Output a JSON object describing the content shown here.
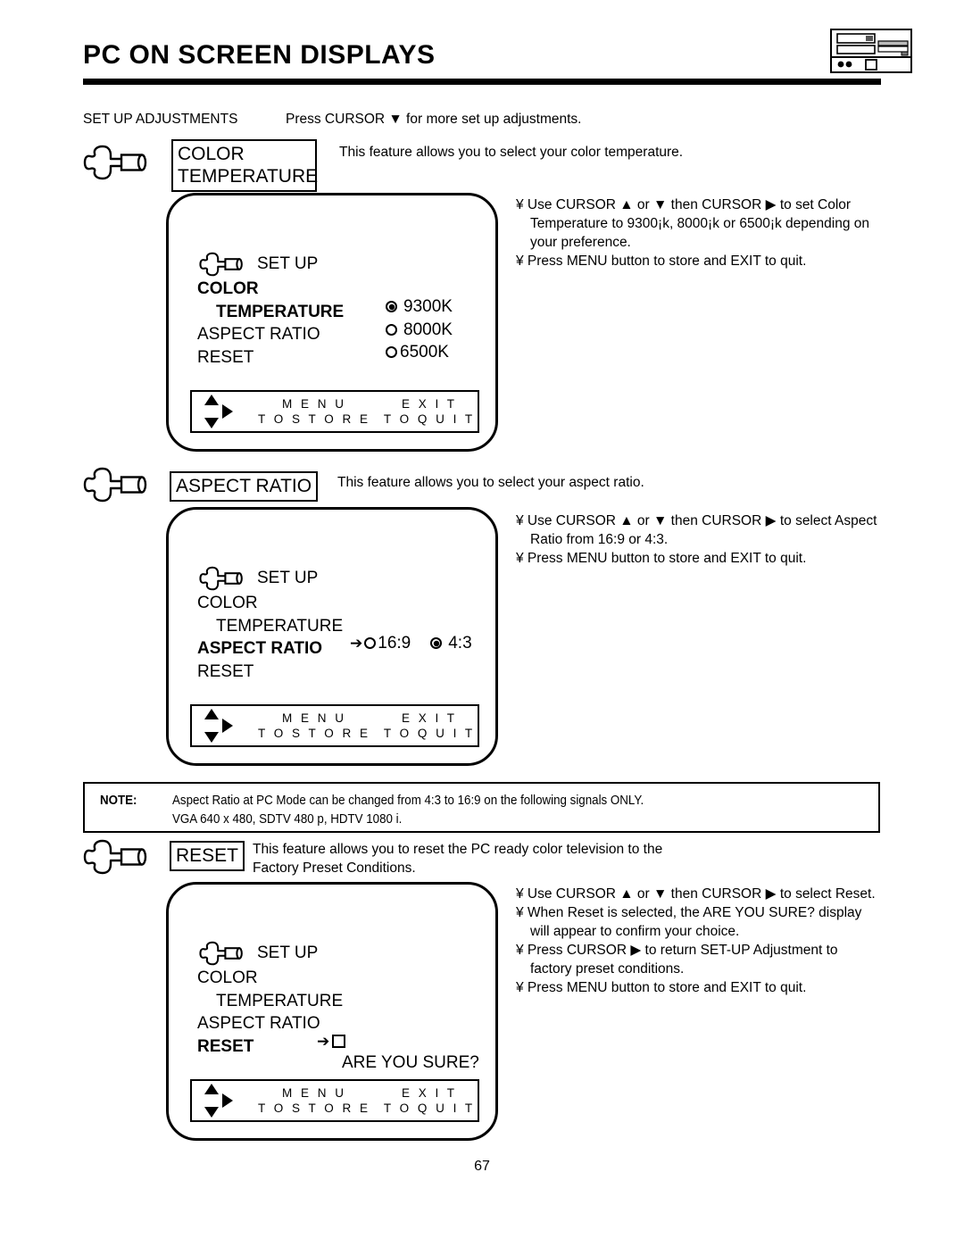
{
  "header": {
    "title": "PC ON SCREEN DISPLAYS",
    "device_icon": "vcr-dvd-player-icon"
  },
  "intro": {
    "label": "SET UP ADJUSTMENTS",
    "text": "Press CURSOR ▼ for more set up adjustments."
  },
  "sections": [
    {
      "icon": "setup-wrench-icon",
      "box_label": "COLOR\nTEMPERATURE",
      "intro": "This feature allows you to select your color temperature.",
      "bullets": [
        "¥ Use CURSOR ▲ or ▼ then CURSOR ▶ to set Color",
        "Temperature to 9300¡k, 8000¡k or 6500¡k depending on",
        "your preference.",
        "¥ Press MENU button to store and EXIT to quit."
      ],
      "osd": {
        "setup_label": "SET UP",
        "setup_icon": "setup-wrench-icon",
        "items": [
          {
            "label": "COLOR",
            "bold": true,
            "indent": false
          },
          {
            "label": "TEMPERATURE",
            "bold": true,
            "indent": true
          },
          {
            "label": "ASPECT RATIO",
            "bold": false,
            "indent": false
          },
          {
            "label": "RESET",
            "bold": false,
            "indent": false
          }
        ],
        "values": [
          {
            "label": "9300K",
            "selected": true
          },
          {
            "label": "8000K",
            "selected": false
          },
          {
            "label": "6500K",
            "selected": false
          }
        ],
        "footer": {
          "menu_top": "M E N U",
          "menu_bottom": "T O  S T O R E",
          "exit_top": "E X I T",
          "exit_bottom": "T O  Q U I T"
        }
      }
    },
    {
      "icon": "setup-wrench-icon",
      "box_label": "ASPECT RATIO",
      "intro": "This feature allows you to select your aspect ratio.",
      "bullets": [
        "¥ Use CURSOR ▲ or ▼ then CURSOR ▶ to select Aspect",
        "Ratio from 16:9 or 4:3.",
        "¥ Press MENU button to store and EXIT to quit."
      ],
      "osd": {
        "setup_label": "SET UP",
        "setup_icon": "setup-wrench-icon",
        "items": [
          {
            "label": "COLOR",
            "bold": false,
            "indent": false
          },
          {
            "label": "TEMPERATURE",
            "bold": false,
            "indent": true
          },
          {
            "label": "ASPECT RATIO",
            "bold": true,
            "indent": false
          },
          {
            "label": "RESET",
            "bold": false,
            "indent": false
          }
        ],
        "aspect_options": [
          {
            "label": "16:9",
            "selected": false,
            "cursor": true
          },
          {
            "label": "4:3",
            "selected": true,
            "cursor": false
          }
        ],
        "footer": {
          "menu_top": "M E N U",
          "menu_bottom": "T O  S T O R E",
          "exit_top": "E X I T",
          "exit_bottom": "T O  Q U I T"
        }
      }
    },
    {
      "icon": "setup-wrench-icon",
      "box_label": "RESET",
      "intro": "This feature allows you to reset the PC ready color television to the",
      "intro2": "Factory Preset Conditions.",
      "bullets": [
        "¥ Use CURSOR ▲ or ▼ then CURSOR ▶ to select Reset.",
        "¥ When Reset is selected, the  ARE YOU SURE?  display",
        "will appear to confirm your choice.",
        "¥ Press CURSOR ▶ to return SET-UP Adjustment to",
        "factory preset conditions.",
        "¥ Press MENU button to store and EXIT to quit."
      ],
      "osd": {
        "setup_label": "SET UP",
        "setup_icon": "setup-wrench-icon",
        "items": [
          {
            "label": "COLOR",
            "bold": false,
            "indent": false
          },
          {
            "label": "TEMPERATURE",
            "bold": false,
            "indent": true
          },
          {
            "label": "ASPECT RATIO",
            "bold": false,
            "indent": false
          },
          {
            "label": "RESET",
            "bold": true,
            "indent": false
          }
        ],
        "confirm_label": "ARE YOU SURE?",
        "footer": {
          "menu_top": "M E N U",
          "menu_bottom": "T O  S T O R E",
          "exit_top": "E X I T",
          "exit_bottom": "T O  Q U I T"
        }
      }
    }
  ],
  "note": {
    "label": "NOTE:",
    "line1": "Aspect Ratio at PC Mode can be changed from 4:3 to 16:9 on the following signals ONLY.",
    "line2": "VGA 640 x 480, SDTV 480 p, HDTV 1080 i."
  },
  "page_number": "67"
}
